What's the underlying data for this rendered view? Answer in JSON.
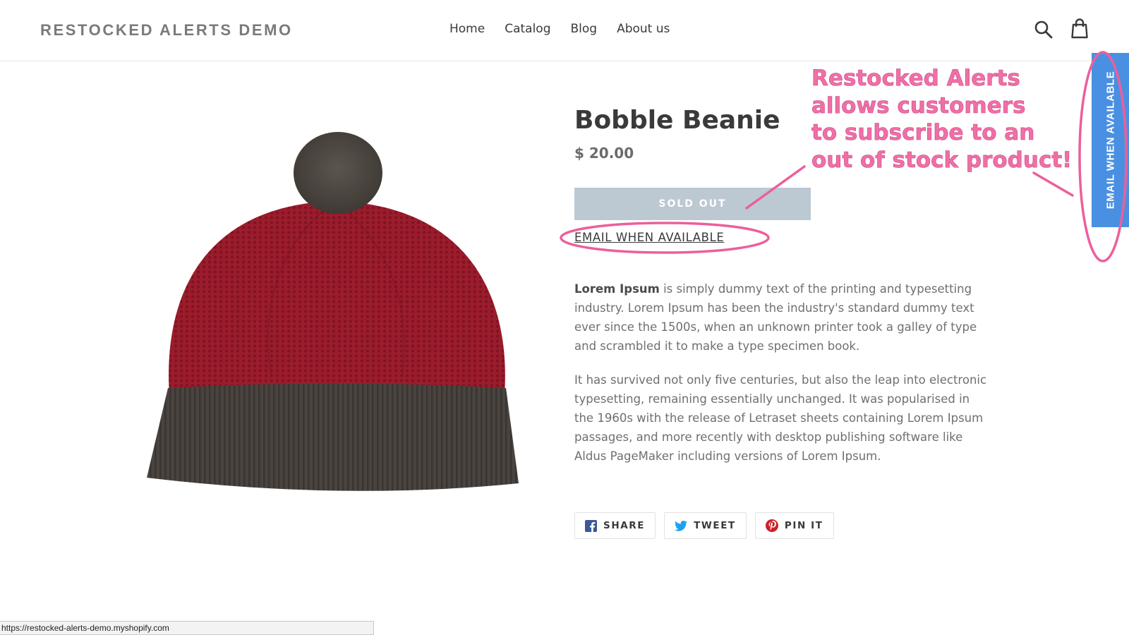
{
  "header": {
    "logo": "RESTOCKED ALERTS DEMO",
    "nav": [
      "Home",
      "Catalog",
      "Blog",
      "About us"
    ],
    "icons": [
      "search-icon",
      "cart-icon"
    ]
  },
  "side_tab": {
    "label": "EMAIL WHEN AVAILABLE",
    "color": "#4a90e2"
  },
  "product": {
    "title": "Bobble Beanie",
    "price": "$ 20.00",
    "button": "SOLD OUT",
    "email_link": "EMAIL WHEN AVAILABLE",
    "description": [
      {
        "bold": "Lorem Ipsum",
        "text": " is simply dummy text of the printing and typesetting industry. Lorem Ipsum has been the industry's standard dummy text ever since the 1500s, when an unknown printer took a galley of type and scrambled it to make a type specimen book."
      },
      {
        "bold": "",
        "text": "It has survived not only five centuries, but also the leap into electronic typesetting, remaining essentially unchanged. It was popularised in the 1960s with the release of Letraset sheets containing Lorem Ipsum passages, and more recently with desktop publishing software like Aldus PageMaker including versions of Lorem Ipsum."
      }
    ]
  },
  "social": {
    "share": "SHARE",
    "tweet": "TWEET",
    "pin": "PIN IT",
    "icons": [
      "facebook-icon",
      "twitter-icon",
      "pinterest-icon"
    ]
  },
  "annotation": {
    "lines": [
      "Restocked Alerts",
      "allows customers",
      "to subscribe to an",
      "out of stock product!"
    ],
    "color": "#f06fa6"
  },
  "status_bar": {
    "url": "https://restocked-alerts-demo.myshopify.com"
  },
  "colors": {
    "sold_out_bg": "#bcc9d3",
    "text": "#3a3a3a",
    "muted": "#6f6f6f"
  }
}
